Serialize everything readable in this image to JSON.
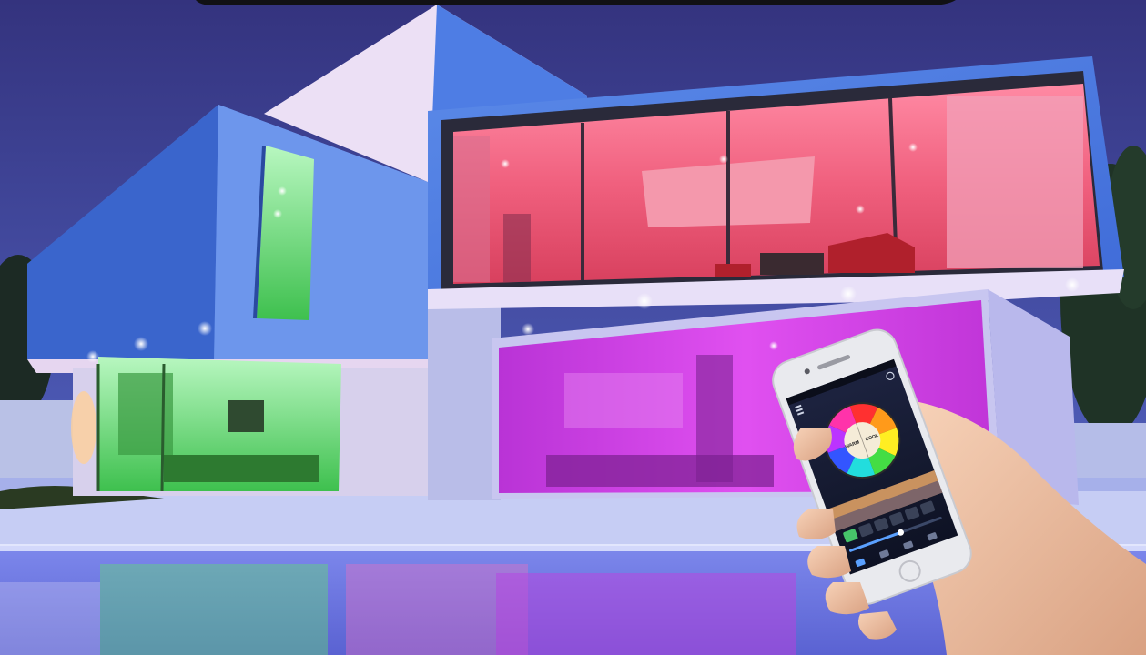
{
  "image": {
    "subject": "",
    "elements": []
  },
  "phone_app": {
    "status_time": "",
    "warm_label": "WARM",
    "cool_label": "COOL",
    "color_wheel": [
      "#ff3030",
      "#ff9a1a",
      "#ffee22",
      "#44dd44",
      "#22dddd",
      "#3355ff",
      "#bb33ff",
      "#ff33aa"
    ],
    "tabs": 4
  },
  "colors": {
    "sky_top": "#3a3a8c",
    "sky_bottom": "#5a6cc4",
    "facade": "#4f7fe0",
    "pink_glass": "#f0607e",
    "magenta_glass": "#d23ee0",
    "green_glass": "#5fe070",
    "pool": "#6f7be6"
  }
}
